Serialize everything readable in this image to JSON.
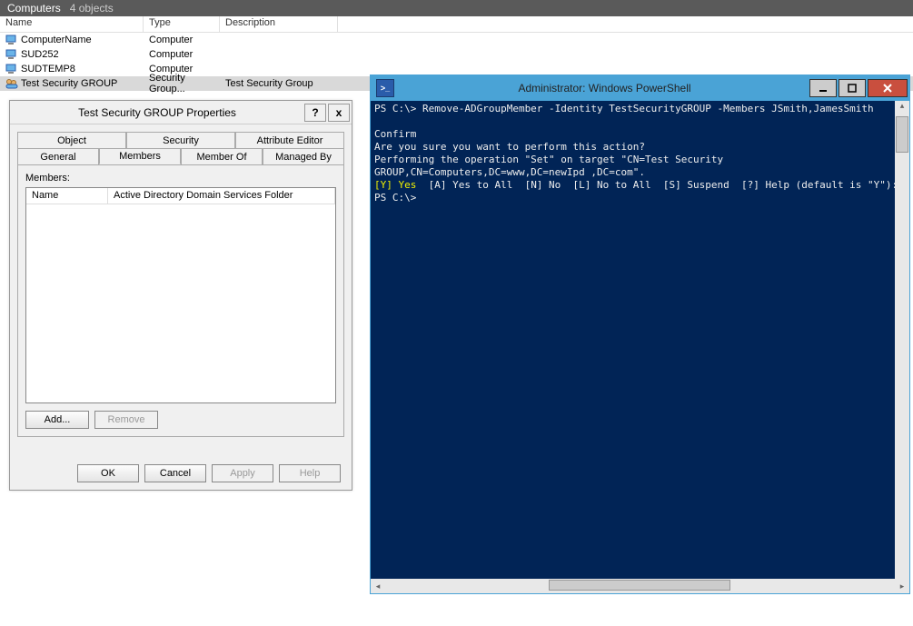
{
  "titlebar": {
    "label": "Computers",
    "count": "4 objects"
  },
  "list": {
    "headers": {
      "name": "Name",
      "type": "Type",
      "desc": "Description"
    },
    "rows": [
      {
        "name": "ComputerName",
        "type": "Computer",
        "desc": "",
        "icon": "computer"
      },
      {
        "name": "SUD252",
        "type": "Computer",
        "desc": "",
        "icon": "computer"
      },
      {
        "name": "SUDTEMP8",
        "type": "Computer",
        "desc": "",
        "icon": "computer"
      },
      {
        "name": "Test Security GROUP",
        "type": "Security Group...",
        "desc": "Test Security Group",
        "icon": "group",
        "selected": true
      }
    ]
  },
  "dialog": {
    "title": "Test Security GROUP Properties",
    "help": "?",
    "close": "x",
    "tabs_row1": [
      "Object",
      "Security",
      "Attribute Editor"
    ],
    "tabs_row2": [
      "General",
      "Members",
      "Member Of",
      "Managed By"
    ],
    "active_tab": "Members",
    "members_label": "Members:",
    "members_headers": {
      "name": "Name",
      "folder": "Active Directory Domain Services Folder"
    },
    "buttons": {
      "add": "Add...",
      "remove": "Remove"
    },
    "footer": {
      "ok": "OK",
      "cancel": "Cancel",
      "apply": "Apply",
      "help": "Help"
    }
  },
  "powershell": {
    "title": "Administrator: Windows PowerShell",
    "lines": [
      {
        "prompt": "PS C:\\>",
        "cmd": " Remove-ADGroupMember -Identity TestSecurityGROUP -Members JSmith,JamesSmith"
      },
      {
        "text": ""
      },
      {
        "text": "Confirm"
      },
      {
        "text": "Are you sure you want to perform this action?"
      },
      {
        "text": "Performing the operation \"Set\" on target \"CN=Test Security"
      },
      {
        "text": "GROUP,CN=Computers,DC=www,DC=newIpd ,DC=com\"."
      },
      {
        "yellow": "[Y] Yes",
        "rest": "  [A] Yes to All  [N] No  [L] No to All  [S] Suspend  [?] Help (default is \"Y\"): y"
      },
      {
        "prompt": "PS C:\\>",
        "cmd": ""
      }
    ]
  }
}
